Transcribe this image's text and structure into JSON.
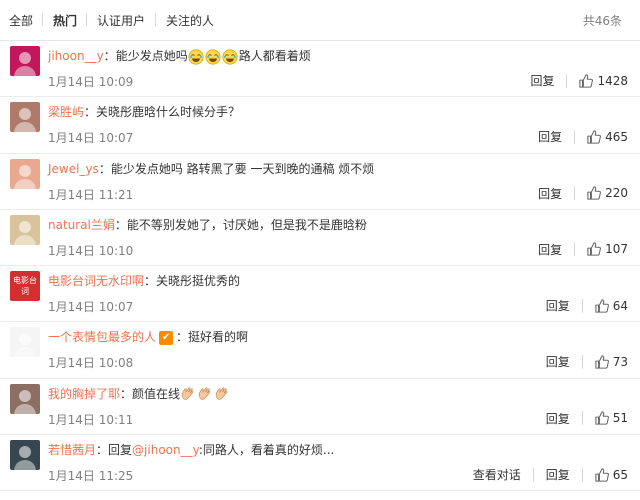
{
  "tabs": [
    {
      "label": "全部",
      "active": false
    },
    {
      "label": "热门",
      "active": true
    },
    {
      "label": "认证用户",
      "active": false
    },
    {
      "label": "关注的人",
      "active": false
    }
  ],
  "total": "共46条",
  "reply_label": "回复",
  "view_conv_label": "查看对话",
  "comments": [
    {
      "user": "jihoon__y",
      "text": "能少发点她吗",
      "text_after": "路人都看着烦",
      "emoji_count": 3,
      "time": "1月14日 10:09",
      "likes": "1428",
      "avatar_color": "#c2185b"
    },
    {
      "user": "梁胜屿",
      "text": "关晓彤鹿晗什么时候分手？",
      "time": "1月14日 10:07",
      "likes": "465",
      "avatar_color": "#b07a6a"
    },
    {
      "user": "Jewel_ys",
      "text": "能少发点她吗 路转黑了要 一天到晚的通稿 烦不烦",
      "time": "1月14日 11:21",
      "likes": "220",
      "avatar_color": "#e8a98f"
    },
    {
      "user": "natural兰娟",
      "text": "能不等别发她了，讨厌她，但是我不是鹿晗粉",
      "time": "1月14日 10:10",
      "likes": "107",
      "avatar_color": "#d9c39a"
    },
    {
      "user": "电影台词无水印啊",
      "text": "关晓彤挺优秀的",
      "time": "1月14日 10:07",
      "likes": "64",
      "avatar_color": "#d32f2f",
      "avatar_text": "电影台词"
    },
    {
      "user": "一个表情包最多的人",
      "text": "挺好看的啊",
      "time": "1月14日 10:08",
      "likes": "73",
      "avatar_color": "#f5f5f5",
      "vip": true
    },
    {
      "user": "我的胸掉了耶",
      "text": "颜值在线",
      "clap_count": 3,
      "time": "1月14日 10:11",
      "likes": "51",
      "avatar_color": "#8d6e63"
    },
    {
      "user": "若惜茜月",
      "text": "回复",
      "mention": "@jihoon__y",
      "text_after": ":同路人，看着真的好烦...",
      "time": "1月14日 11:25",
      "likes": "65",
      "avatar_color": "#37474f",
      "view_conv": true
    }
  ]
}
